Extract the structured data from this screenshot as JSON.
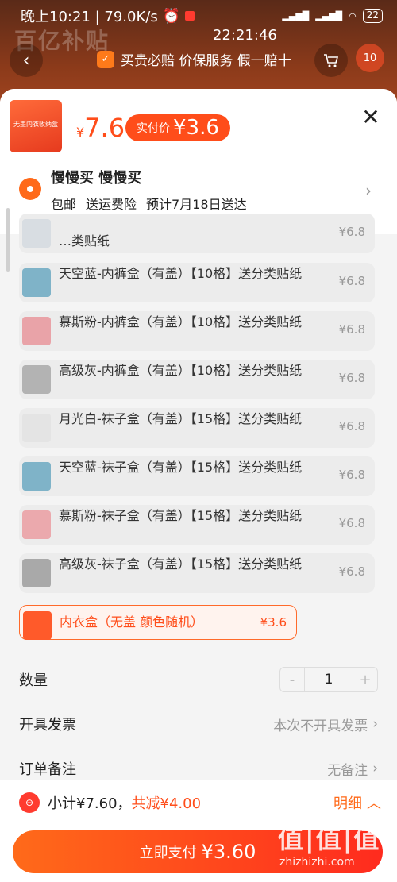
{
  "status_bar": {
    "left_text": "晚上10:21 | 79.0K/s",
    "time_overlay": "22:21:46",
    "battery": "22"
  },
  "background": {
    "brand": "百亿补贴",
    "guarantee_text": "买贵必赔 价保服务 假一赔十",
    "cart_count": "10"
  },
  "product": {
    "thumb_text": "无盖内衣收纳盒",
    "price_yen": "¥",
    "price_value": "7.6",
    "real_price_label": "实付价",
    "real_price_value": "¥3.6"
  },
  "address": {
    "name": "慢慢买 慢慢买",
    "shipping": [
      "包邮",
      "送运费险",
      "预计7月18日送达"
    ]
  },
  "options": [
    {
      "text": "…类贴纸",
      "price": "¥6.8",
      "color": "#d8dde2"
    },
    {
      "text": "天空蓝-内裤盒（有盖）【10格】送分类贴纸",
      "price": "¥6.8",
      "color": "#7fb3c8"
    },
    {
      "text": "慕斯粉-内裤盒（有盖）【10格】送分类贴纸",
      "price": "¥6.8",
      "color": "#e9a3a8"
    },
    {
      "text": "高级灰-内裤盒（有盖）【10格】送分类贴纸",
      "price": "¥6.8",
      "color": "#b3b3b3"
    },
    {
      "text": "月光白-袜子盒（有盖）【15格】送分类贴纸",
      "price": "¥6.8",
      "color": "#e4e4e4"
    },
    {
      "text": "天空蓝-袜子盒（有盖）【15格】送分类贴纸",
      "price": "¥6.8",
      "color": "#7fb3c8"
    },
    {
      "text": "慕斯粉-袜子盒（有盖）【15格】送分类贴纸",
      "price": "¥6.8",
      "color": "#eba9ad"
    },
    {
      "text": "高级灰-袜子盒（有盖）【15格】送分类贴纸",
      "price": "¥6.8",
      "color": "#a9a9a9"
    }
  ],
  "selected_option": {
    "text": "内衣盒（无盖 颜色随机）",
    "price": "¥3.6"
  },
  "quantity": {
    "label": "数量",
    "minus": "-",
    "value": "1",
    "plus": "+"
  },
  "invoice": {
    "label": "开具发票",
    "value": "本次不开具发票"
  },
  "note": {
    "label": "订单备注",
    "value": "无备注"
  },
  "bottom": {
    "subtotal": "小计¥7.60，",
    "saved": "共减¥4.00",
    "detail": "明细",
    "pay_label": "立即支付",
    "pay_value": "¥3.60"
  },
  "watermark": {
    "main": "值|值|值",
    "sub": "zhizhizhi.com"
  },
  "colors": {
    "accent": "#ff4d1a",
    "accent_light": "#ff6a1a"
  }
}
